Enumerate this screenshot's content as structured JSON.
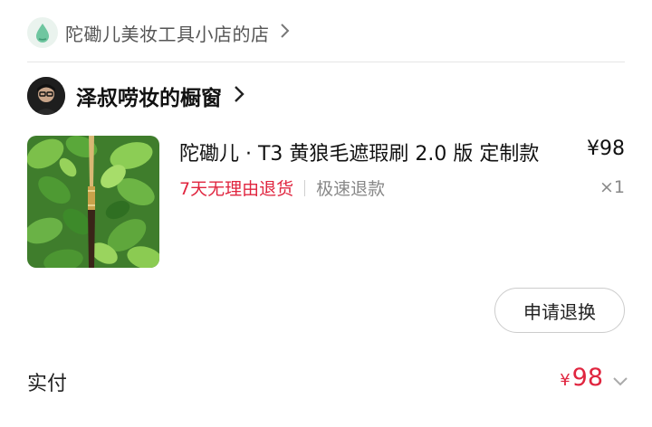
{
  "store": {
    "name": "陀磡儿美妆工具小店的店",
    "logo_icon": "droplet-logo-icon",
    "chevron_icon": "chevron-right-icon"
  },
  "window": {
    "name": "泽叔唠妆的橱窗",
    "avatar_icon": "person-avatar",
    "chevron_icon": "chevron-right-icon"
  },
  "product": {
    "title": "陀磡儿 · T3 黄狼毛遮瑕刷 2.0 版 定制款",
    "price": "¥98",
    "tag_return": "7天无理由退货",
    "tag_refund": "极速退款",
    "quantity": "×1",
    "image_icon": "makeup-brush-on-leaves-image"
  },
  "actions": {
    "refund_exchange_label": "申请退换"
  },
  "payment": {
    "label": "实付",
    "currency": "¥",
    "amount": "98",
    "chevron_icon": "chevron-down-icon"
  },
  "colors": {
    "accent_red": "#e0253f",
    "muted_gray": "#888888",
    "divider": "#e6e6e6"
  }
}
